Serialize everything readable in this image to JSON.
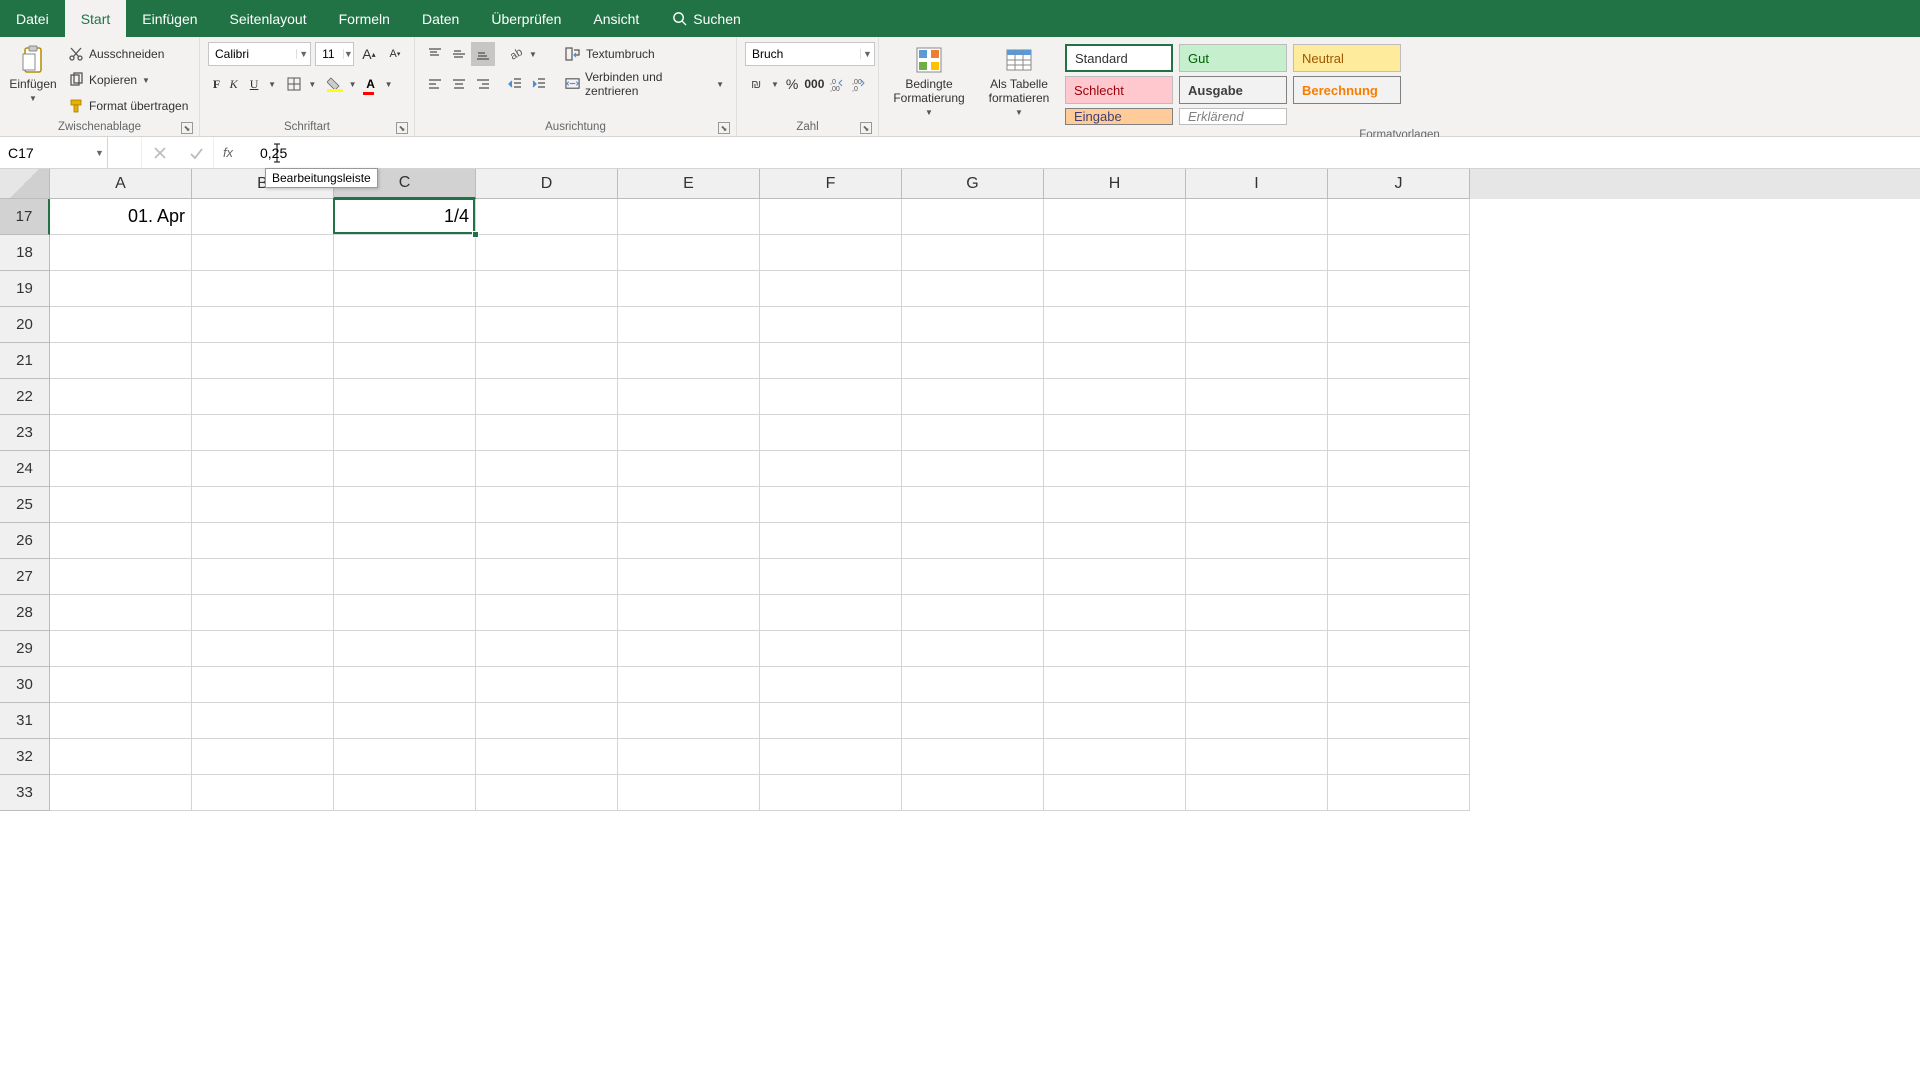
{
  "menubar": {
    "tabs": [
      "Datei",
      "Start",
      "Einfügen",
      "Seitenlayout",
      "Formeln",
      "Daten",
      "Überprüfen",
      "Ansicht"
    ],
    "active_index": 1,
    "search_placeholder": "Suchen"
  },
  "ribbon": {
    "clipboard": {
      "paste": "Einfügen",
      "cut": "Ausschneiden",
      "copy": "Kopieren",
      "format_painter": "Format übertragen",
      "group_label": "Zwischenablage"
    },
    "font": {
      "name": "Calibri",
      "size": "11",
      "bold": "F",
      "italic": "K",
      "underline": "U",
      "group_label": "Schriftart"
    },
    "alignment": {
      "wrap": "Textumbruch",
      "merge": "Verbinden und zentrieren",
      "group_label": "Ausrichtung"
    },
    "number": {
      "format": "Bruch",
      "group_label": "Zahl"
    },
    "styles": {
      "conditional": "Bedingte\nFormatierung",
      "as_table": "Als Tabelle\nformatieren",
      "items": [
        "Standard",
        "Gut",
        "Neutral",
        "Schlecht",
        "Ausgabe",
        "Berechnung",
        "Eingabe",
        "Erklärend"
      ],
      "group_label": "Formatvorlagen"
    }
  },
  "formulabar": {
    "namebox": "C17",
    "formula": "0,25",
    "tooltip": "Bearbeitungsleiste",
    "fx": "fx"
  },
  "grid": {
    "columns": [
      "A",
      "B",
      "C",
      "D",
      "E",
      "F",
      "G",
      "H",
      "I",
      "J"
    ],
    "selected_col_index": 2,
    "first_row": 17,
    "row_count": 17,
    "selected_row_index": 0,
    "cells": {
      "A17": "01. Apr",
      "C17": "1/4"
    }
  }
}
